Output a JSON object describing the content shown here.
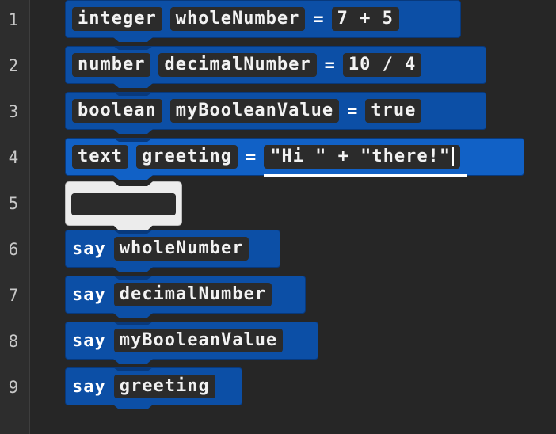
{
  "line_numbers": [
    "1",
    "2",
    "3",
    "4",
    "5",
    "6",
    "7",
    "8",
    "9"
  ],
  "blocks": [
    {
      "type": "integer",
      "name": "wholeNumber",
      "op": "=",
      "value": "7 + 5"
    },
    {
      "type": "number",
      "name": "decimalNumber",
      "op": "=",
      "value": "10 / 4"
    },
    {
      "type": "boolean",
      "name": "myBooleanValue",
      "op": "=",
      "value": "true"
    },
    {
      "type": "text",
      "name": "greeting",
      "op": "=",
      "value": "\"Hi \" + \"there!\""
    }
  ],
  "say_blocks": [
    {
      "keyword": "say",
      "arg": "wholeNumber"
    },
    {
      "keyword": "say",
      "arg": "decimalNumber"
    },
    {
      "keyword": "say",
      "arg": "myBooleanValue"
    },
    {
      "keyword": "say",
      "arg": "greeting"
    }
  ],
  "colors": {
    "block": "#0c4fa6",
    "block_active": "#1161c6",
    "chip": "#2b2b2b",
    "background": "#262626",
    "empty_block": "#ececec"
  }
}
